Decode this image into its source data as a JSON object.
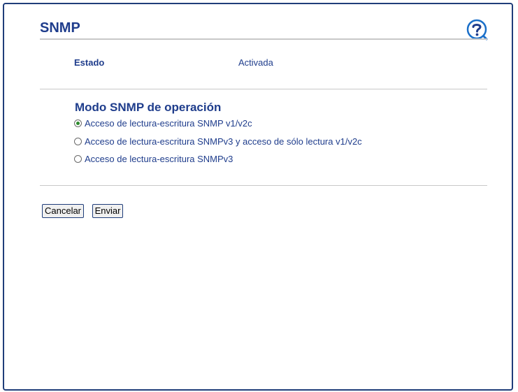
{
  "page": {
    "title": "SNMP",
    "help_icon": "help-question-icon"
  },
  "status": {
    "label": "Estado",
    "value": "Activada"
  },
  "mode": {
    "heading": "Modo SNMP de operación",
    "options": [
      {
        "label": "Acceso de lectura-escritura SNMP v1/v2c",
        "selected": true
      },
      {
        "label": "Acceso de lectura-escritura SNMPv3 y acceso de sólo lectura v1/v2c",
        "selected": false
      },
      {
        "label": "Acceso de lectura-escritura SNMPv3",
        "selected": false
      }
    ]
  },
  "buttons": {
    "cancel_label": "Cancelar",
    "submit_label": "Enviar"
  },
  "colors": {
    "accent": "#1f3d8c",
    "help_icon": "#1a6fc9",
    "radio_selected": "#2e8b2e"
  }
}
